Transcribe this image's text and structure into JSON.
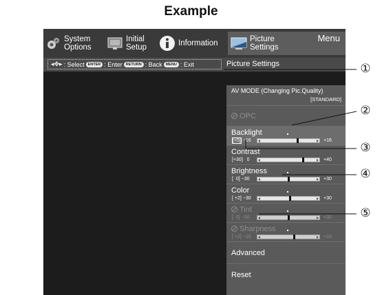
{
  "heading": "Example",
  "menubar": {
    "tabs": [
      {
        "label": "System\nOptions",
        "icon": "system-options-icon"
      },
      {
        "label": "Initial\nSetup",
        "icon": "initial-setup-icon"
      },
      {
        "label": "Information",
        "icon": "information-icon"
      },
      {
        "label": "Picture\nSettings",
        "icon": "picture-settings-icon",
        "active": true
      }
    ],
    "title": "Menu"
  },
  "status": {
    "guide": {
      "select": ": Select",
      "enter_key": "ENTER",
      "enter": ": Enter",
      "return_key": "RETURN",
      "back": ": Back",
      "menu_key": "MENU",
      "exit": ": Exit"
    },
    "path": "Picture Settings"
  },
  "panel": {
    "av_mode": {
      "label": "AV MODE (Changing Pic.Quality)",
      "value": "[STANDARD]"
    },
    "opc": {
      "label": "OPC"
    },
    "backlight": {
      "label": "Backlight",
      "value": "[+5]",
      "min": "−16",
      "max": "+16",
      "level": 0.66
    },
    "contrast": {
      "label": "Contrast",
      "value": "[+30]",
      "min": "0",
      "max": "+40",
      "level": 0.75
    },
    "brightness": {
      "label": "Brightness",
      "value": "[  0]",
      "min": "−30",
      "max": "+30",
      "level": 0.5
    },
    "color": {
      "label": "Color",
      "value": "[ +2]",
      "min": "−30",
      "max": "+30",
      "level": 0.53
    },
    "tint": {
      "label": "Tint",
      "value": "[  0]",
      "min": "−30",
      "max": "+30",
      "level": 0.5
    },
    "sharpness": {
      "label": "Sharpness",
      "value": "[ +2]",
      "min": "−10",
      "max": "+10",
      "level": 0.6
    },
    "advanced": {
      "label": "Advanced"
    },
    "reset": {
      "label": "Reset"
    }
  },
  "callouts": [
    "①",
    "②",
    "③",
    "④",
    "⑤"
  ]
}
